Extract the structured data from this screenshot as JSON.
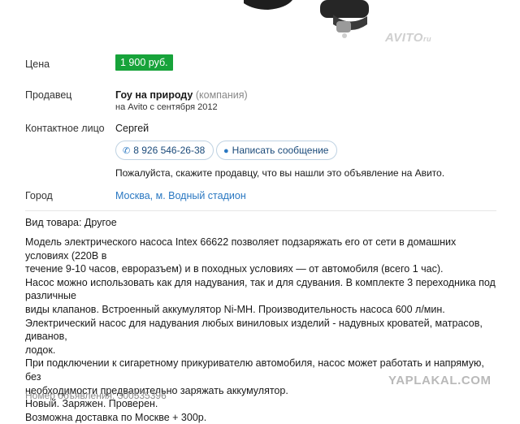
{
  "watermark": {
    "avito": "AVITO",
    "avito_suffix": "ru",
    "site": "YAPLAKAL.COM"
  },
  "price": {
    "label": "Цена",
    "value": "1 900 руб.",
    "color": "#17a33a"
  },
  "seller": {
    "label": "Продавец",
    "name": "Гоу на природу",
    "type": "(компания)",
    "since": "на Avito с сентября 2012"
  },
  "contact": {
    "label": "Контактное лицо",
    "name": "Сергей",
    "phone": "8 926 546-26-38",
    "message_button": "Написать сообщение",
    "note": "Пожалуйста, скажите продавцу, что вы нашли это объявление на Авито."
  },
  "city": {
    "label": "Город",
    "value": "Москва, м. Водный стадион"
  },
  "item_type": "Вид товара: Другое",
  "description": [
    "Модель электрического насоса Intex 66622 позволяет подзаряжать его от сети в домашних условиях (220В в",
    "течение 9-10 часов, евроразъем) и в походных условиях — от автомобиля (всего 1 час).",
    "Насос можно использовать как для надувания, так и для сдувания. В комплекте 3 переходника под различные",
    "виды клапанов. Встроенный аккумулятор Ni-MH. Производительность насоса 600 л/мин.",
    "Электрический насос для надувания любых виниловых изделий - надувных кроватей, матрасов, диванов,",
    "лодок.",
    "При подключении к сигаретному прикуривателю автомобиля, насос может работать и напрямую, без",
    "необходимости предварительно заряжать аккумулятор.",
    "Новый. Заряжен. Проверен.",
    "Возможна доставка по Москве + 300р."
  ],
  "ad_number": "Номер объявления: 300535396"
}
